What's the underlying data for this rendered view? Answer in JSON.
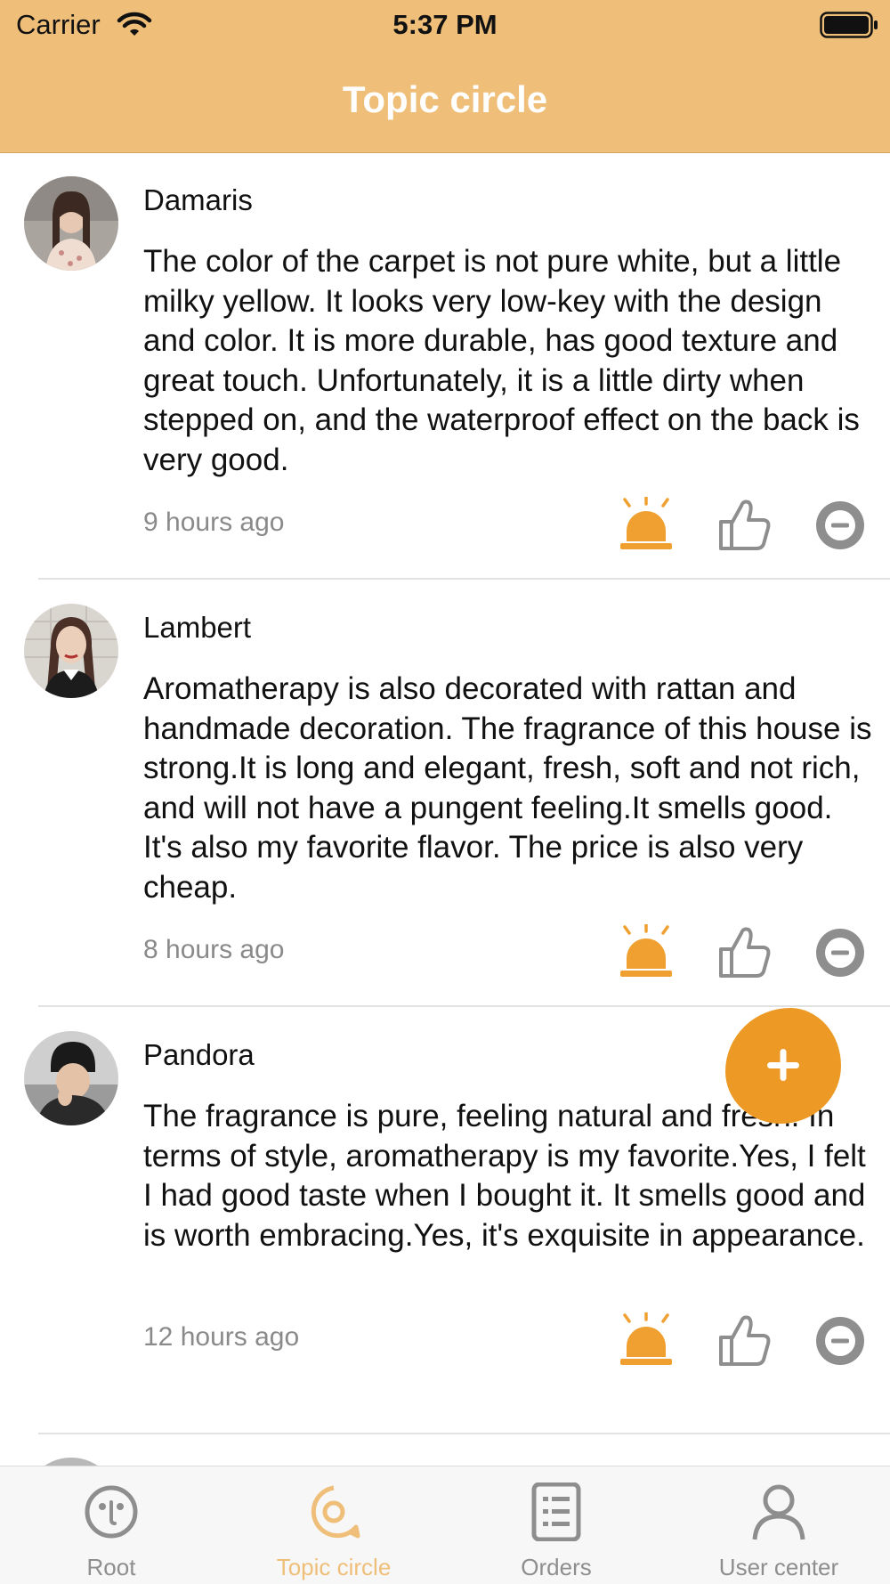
{
  "status_bar": {
    "carrier": "Carrier",
    "time": "5:37 PM"
  },
  "nav": {
    "title": "Topic circle"
  },
  "posts": [
    {
      "username": "Damaris",
      "content": "The color of the carpet is not pure white, but a little milky yellow. It looks very low-key with the design and color. It is more durable, has good texture and great touch. Unfortunately, it is a little dirty when stepped on, and the waterproof effect on the back is very good.",
      "time": "9 hours ago"
    },
    {
      "username": "Lambert",
      "content": "Aromatherapy is also decorated with rattan and handmade decoration. The fragrance of this house is strong.It is long and elegant, fresh, soft and not rich, and will not have a pungent feeling.It smells good. It's also my favorite flavor. The price is also very cheap.",
      "time": "8 hours ago"
    },
    {
      "username": "Pandora",
      "content": "The fragrance is pure, feeling natural and fresh. In terms of style, aromatherapy is my favorite.Yes, I felt I had good taste when I bought it. It smells good and is worth embracing.Yes, it's exquisite in appearance.",
      "time": "12 hours ago"
    }
  ],
  "tabs": [
    {
      "label": "Root",
      "icon": "smile-face-icon",
      "active": false
    },
    {
      "label": "Topic circle",
      "icon": "chat-bubble-icon",
      "active": true
    },
    {
      "label": "Orders",
      "icon": "orders-list-icon",
      "active": false
    },
    {
      "label": "User center",
      "icon": "user-icon",
      "active": false
    }
  ],
  "colors": {
    "header": "#efbf7a",
    "accent": "#ec9a25",
    "alarm": "#f0a030",
    "inactive": "#8e8e8e"
  }
}
